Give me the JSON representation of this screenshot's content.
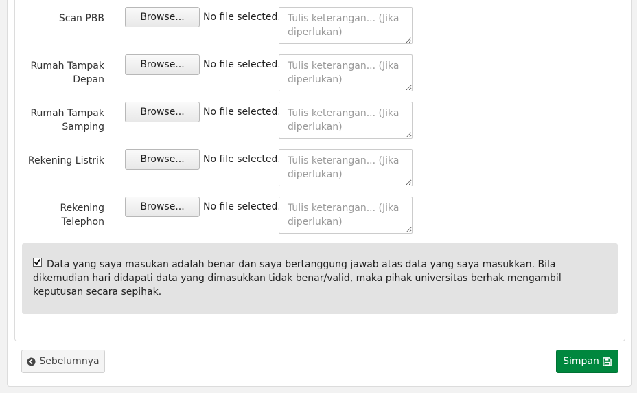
{
  "uploads": [
    {
      "label": "Scan PBB",
      "browse_label": "Browse...",
      "file_status": "No file selected.",
      "note_placeholder": "Tulis keterangan... (Jika diperlukan)"
    },
    {
      "label": "Rumah Tampak Depan",
      "browse_label": "Browse...",
      "file_status": "No file selected.",
      "note_placeholder": "Tulis keterangan... (Jika diperlukan)"
    },
    {
      "label": "Rumah Tampak Samping",
      "browse_label": "Browse...",
      "file_status": "No file selected.",
      "note_placeholder": "Tulis keterangan... (Jika diperlukan)"
    },
    {
      "label": "Rekening Listrik",
      "browse_label": "Browse...",
      "file_status": "No file selected.",
      "note_placeholder": "Tulis keterangan... (Jika diperlukan)"
    },
    {
      "label": "Rekening Telephon",
      "browse_label": "Browse...",
      "file_status": "No file selected.",
      "note_placeholder": "Tulis keterangan... (Jika diperlukan)"
    }
  ],
  "agreement": {
    "checked": true,
    "text": "Data yang saya masukan adalah benar dan saya bertanggung jawab atas data yang saya masukkan. Bila dikemudian hari didapati data yang dimasukkan tidak benar/valid, maka pihak universitas berhak mengambil keputusan secara sepihak."
  },
  "footer": {
    "prev_label": "Sebelumnya",
    "prev_icon": "arrow-circle-left-icon",
    "save_label": "Simpan",
    "save_icon": "floppy-disk-icon",
    "save_color": "#00873e"
  }
}
